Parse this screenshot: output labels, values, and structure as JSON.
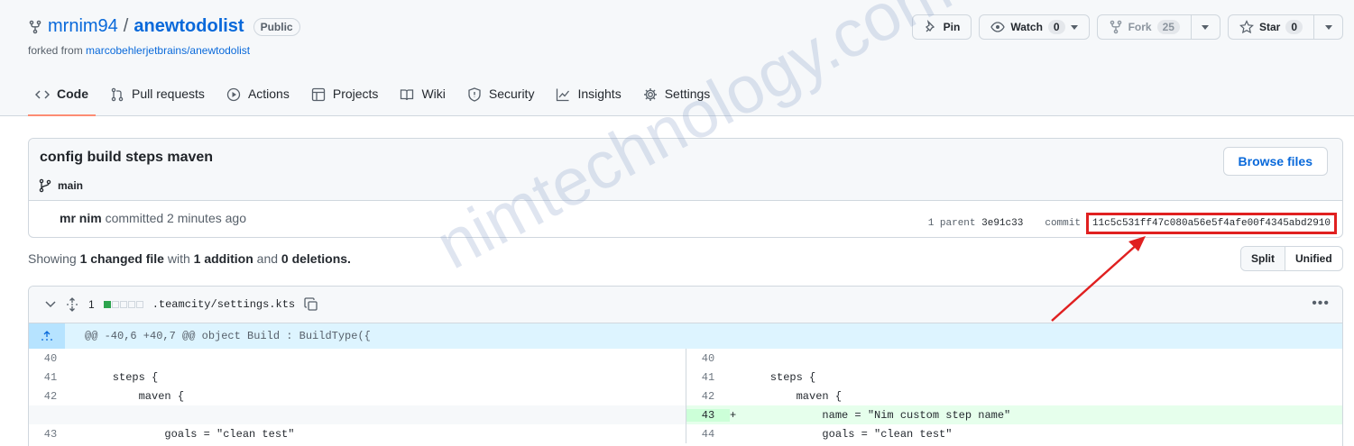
{
  "repo": {
    "owner": "mrnim94",
    "slash": "/",
    "name": "anewtodolist",
    "visibility": "Public",
    "forked_prefix": "forked from ",
    "forked_from": "marcobehlerjetbrains/anewtodolist"
  },
  "actions": {
    "pin": "Pin",
    "watch": "Watch",
    "watch_count": "0",
    "fork": "Fork",
    "fork_count": "25",
    "star": "Star",
    "star_count": "0"
  },
  "tabs": [
    {
      "label": "Code",
      "icon": "code-icon"
    },
    {
      "label": "Pull requests",
      "icon": "git-pull-request-icon"
    },
    {
      "label": "Actions",
      "icon": "play-icon"
    },
    {
      "label": "Projects",
      "icon": "table-icon"
    },
    {
      "label": "Wiki",
      "icon": "book-icon"
    },
    {
      "label": "Security",
      "icon": "shield-icon"
    },
    {
      "label": "Insights",
      "icon": "graph-icon"
    },
    {
      "label": "Settings",
      "icon": "gear-icon"
    }
  ],
  "commit": {
    "title": "config build steps maven",
    "branch": "main",
    "browse": "Browse files",
    "author": "mr nim",
    "committed": "committed 2 minutes ago",
    "parent_label": "1 parent",
    "parent_sha": "3e91c33",
    "commit_label": "commit",
    "sha": "11c5c531ff47c080a56e5f4afe00f4345abd2910"
  },
  "summary": {
    "showing": "Showing",
    "changed": "1 changed file",
    "with": "with",
    "additions": "1 addition",
    "and": "and",
    "deletions": "0 deletions."
  },
  "view": {
    "split": "Split",
    "unified": "Unified"
  },
  "file": {
    "count": "1",
    "path": ".teamcity/settings.kts",
    "hunk": "@@ -40,6 +40,7 @@ object Build : BuildType({"
  },
  "diff_left": [
    {
      "num": "40",
      "code": ""
    },
    {
      "num": "41",
      "code": "    steps {"
    },
    {
      "num": "42",
      "code": "        maven {"
    },
    {
      "num": "",
      "code": ""
    },
    {
      "num": "43",
      "code": "            goals = \"clean test\""
    }
  ],
  "diff_right": [
    {
      "num": "40",
      "code": "",
      "sign": ""
    },
    {
      "num": "41",
      "code": "    steps {",
      "sign": ""
    },
    {
      "num": "42",
      "code": "        maven {",
      "sign": ""
    },
    {
      "num": "43",
      "code": "            name = \"Nim custom step name\"",
      "sign": "+"
    },
    {
      "num": "44",
      "code": "            goals = \"clean test\"",
      "sign": ""
    }
  ],
  "watermark": "nimtechnology.com",
  "colors": {
    "accent": "#0969da",
    "tab_underline": "#fd8c73",
    "highlight": "#e02020",
    "add_bg": "#e6ffec"
  }
}
